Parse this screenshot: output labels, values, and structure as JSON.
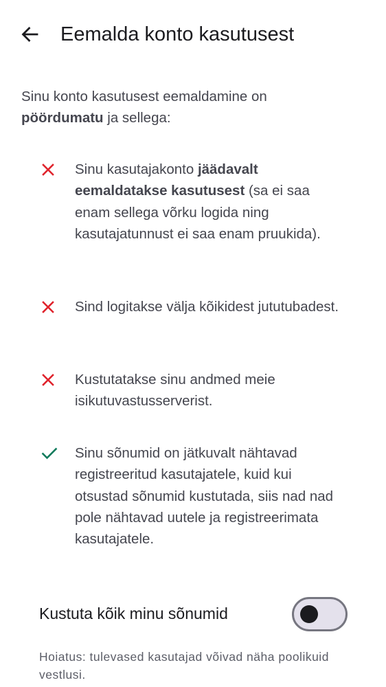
{
  "header": {
    "title": "Eemalda konto kasutusest",
    "back_icon": "arrow-back-icon"
  },
  "intro": {
    "text_before": "Sinu konto kasutusest eemaldamine on ",
    "text_bold": "pöördumatu",
    "text_after": " ja sellega:"
  },
  "consequences": [
    {
      "icon": "cross-icon",
      "color": "#e0242d",
      "text_before": "Sinu kasutajakonto ",
      "text_bold": "jäädavalt eemaldatakse kasutusest",
      "text_after": " (sa ei saa enam sellega võrku logida ning kasutajatunnust ei saa enam pruukida)."
    },
    {
      "icon": "cross-icon",
      "color": "#e0242d",
      "text_before": "Sind logitakse välja kõikidest jututubadest.",
      "text_bold": "",
      "text_after": ""
    },
    {
      "icon": "cross-icon",
      "color": "#e0242d",
      "text_before": "Kustutatakse sinu andmed meie isikutuvastusserverist.",
      "text_bold": "",
      "text_after": ""
    },
    {
      "icon": "check-icon",
      "color": "#0b7b5c",
      "text_before": "Sinu sõnumid on jätkuvalt nähtavad registreeritud kasutajatele, kuid kui otsustad sõnumid kustutada, siis nad nad pole nähtavad uutele ja registreerimata kasutajatele.",
      "text_bold": "",
      "text_after": ""
    }
  ],
  "toggle": {
    "label": "Kustuta kõik minu sõnumid",
    "checked": false
  },
  "warning": "Hoiatus: tulevased kasutajad võivad näha poolikuid vestlusi."
}
